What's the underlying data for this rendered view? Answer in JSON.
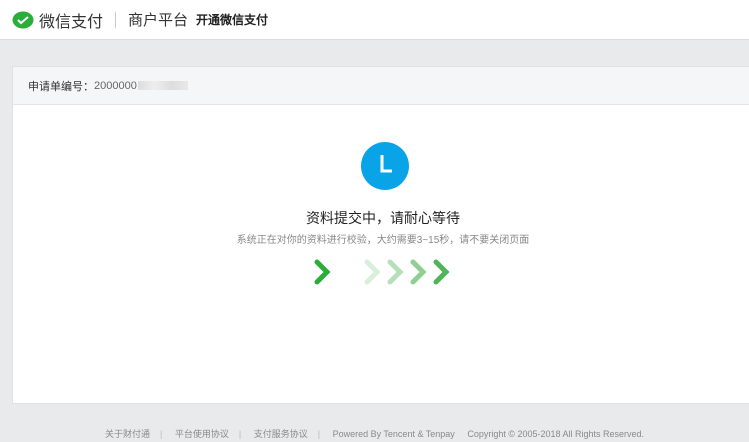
{
  "header": {
    "brand": "微信支付",
    "platform": "商户平台",
    "subtitle": "开通微信支付"
  },
  "card": {
    "order_label": "申请单编号：",
    "order_value": "2000000"
  },
  "status": {
    "title": "资料提交中，请耐心等待",
    "description": "系统正在对你的资料进行校验，大约需要3~15秒，请不要关闭页面"
  },
  "footer": {
    "links": [
      "关于财付通",
      "平台使用协议",
      "支付服务协议"
    ],
    "powered": "Powered By Tencent & Tenpay",
    "copyright": "Copyright © 2005-2018 All Rights Reserved."
  },
  "colors": {
    "green": "#2aae3a",
    "blue": "#09a3e8"
  }
}
